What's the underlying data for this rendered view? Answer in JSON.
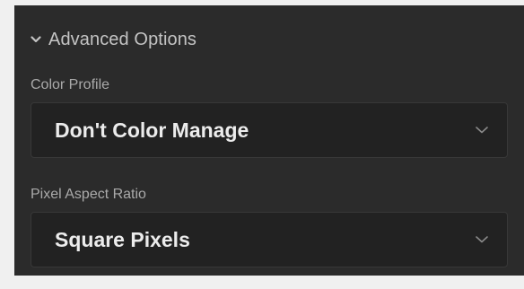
{
  "section": {
    "title": "Advanced Options",
    "icon": "chevron-down-icon"
  },
  "fields": {
    "color_profile": {
      "label": "Color Profile",
      "value": "Don't Color Manage",
      "icon": "chevron-down-icon"
    },
    "pixel_aspect_ratio": {
      "label": "Pixel Aspect Ratio",
      "value": "Square Pixels",
      "icon": "chevron-down-icon"
    }
  },
  "colors": {
    "panel_bg": "#2b2b2b",
    "select_bg": "#222222",
    "label_text": "#aaaaaa",
    "value_text": "#ececec"
  }
}
